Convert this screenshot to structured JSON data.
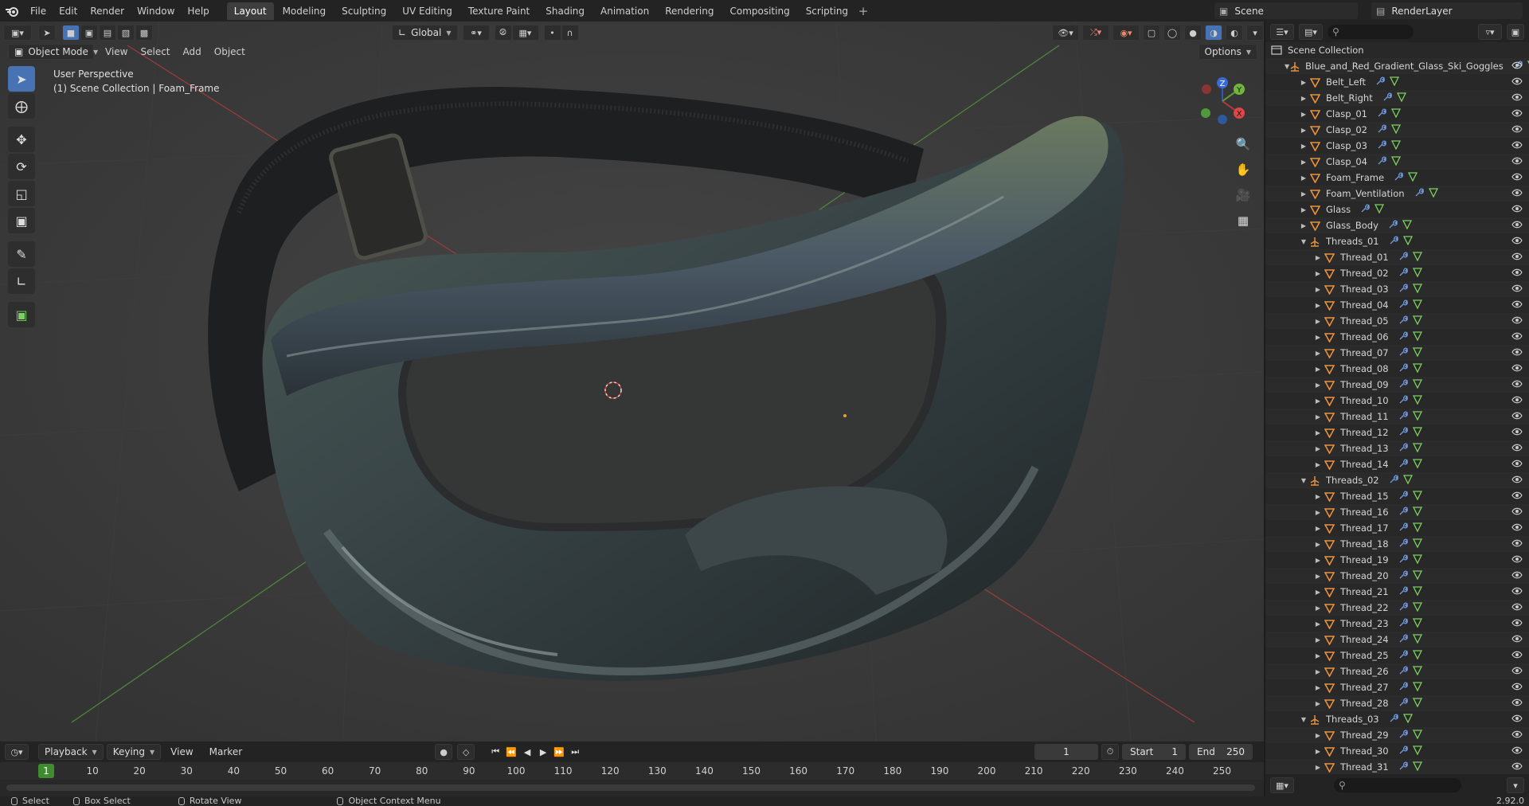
{
  "topbar": {
    "menu": [
      "File",
      "Edit",
      "Render",
      "Window",
      "Help"
    ],
    "workspaces": [
      "Layout",
      "Modeling",
      "Sculpting",
      "UV Editing",
      "Texture Paint",
      "Shading",
      "Animation",
      "Rendering",
      "Compositing",
      "Scripting"
    ],
    "active_workspace": "Layout",
    "add_tab": "+",
    "scene": "Scene",
    "view_layer": "RenderLayer"
  },
  "viewport": {
    "mode": "Object Mode",
    "menu": [
      "View",
      "Select",
      "Add",
      "Object"
    ],
    "transform_orientation": "Global",
    "options_label": "Options",
    "perspective_label": "User Perspective",
    "collection_label": "(1) Scene Collection | Foam_Frame",
    "gizmo_axes": [
      "X",
      "Y",
      "Z"
    ]
  },
  "outliner": {
    "root": "Scene Collection",
    "items": [
      {
        "label": "Blue_and_Red_Gradient_Glass_Ski_Goggles",
        "depth": 1,
        "type": "empty",
        "expanded": true
      },
      {
        "label": "Belt_Left",
        "depth": 2,
        "type": "mesh"
      },
      {
        "label": "Belt_Right",
        "depth": 2,
        "type": "mesh"
      },
      {
        "label": "Clasp_01",
        "depth": 2,
        "type": "mesh"
      },
      {
        "label": "Clasp_02",
        "depth": 2,
        "type": "mesh"
      },
      {
        "label": "Clasp_03",
        "depth": 2,
        "type": "mesh"
      },
      {
        "label": "Clasp_04",
        "depth": 2,
        "type": "mesh"
      },
      {
        "label": "Foam_Frame",
        "depth": 2,
        "type": "mesh"
      },
      {
        "label": "Foam_Ventilation",
        "depth": 2,
        "type": "mesh"
      },
      {
        "label": "Glass",
        "depth": 2,
        "type": "mesh"
      },
      {
        "label": "Glass_Body",
        "depth": 2,
        "type": "mesh"
      },
      {
        "label": "Threads_01",
        "depth": 2,
        "type": "empty",
        "expanded": true
      },
      {
        "label": "Thread_01",
        "depth": 3,
        "type": "mesh"
      },
      {
        "label": "Thread_02",
        "depth": 3,
        "type": "mesh"
      },
      {
        "label": "Thread_03",
        "depth": 3,
        "type": "mesh"
      },
      {
        "label": "Thread_04",
        "depth": 3,
        "type": "mesh"
      },
      {
        "label": "Thread_05",
        "depth": 3,
        "type": "mesh"
      },
      {
        "label": "Thread_06",
        "depth": 3,
        "type": "mesh"
      },
      {
        "label": "Thread_07",
        "depth": 3,
        "type": "mesh"
      },
      {
        "label": "Thread_08",
        "depth": 3,
        "type": "mesh"
      },
      {
        "label": "Thread_09",
        "depth": 3,
        "type": "mesh"
      },
      {
        "label": "Thread_10",
        "depth": 3,
        "type": "mesh"
      },
      {
        "label": "Thread_11",
        "depth": 3,
        "type": "mesh"
      },
      {
        "label": "Thread_12",
        "depth": 3,
        "type": "mesh"
      },
      {
        "label": "Thread_13",
        "depth": 3,
        "type": "mesh"
      },
      {
        "label": "Thread_14",
        "depth": 3,
        "type": "mesh"
      },
      {
        "label": "Threads_02",
        "depth": 2,
        "type": "empty",
        "expanded": true
      },
      {
        "label": "Thread_15",
        "depth": 3,
        "type": "mesh"
      },
      {
        "label": "Thread_16",
        "depth": 3,
        "type": "mesh"
      },
      {
        "label": "Thread_17",
        "depth": 3,
        "type": "mesh"
      },
      {
        "label": "Thread_18",
        "depth": 3,
        "type": "mesh"
      },
      {
        "label": "Thread_19",
        "depth": 3,
        "type": "mesh"
      },
      {
        "label": "Thread_20",
        "depth": 3,
        "type": "mesh"
      },
      {
        "label": "Thread_21",
        "depth": 3,
        "type": "mesh"
      },
      {
        "label": "Thread_22",
        "depth": 3,
        "type": "mesh"
      },
      {
        "label": "Thread_23",
        "depth": 3,
        "type": "mesh"
      },
      {
        "label": "Thread_24",
        "depth": 3,
        "type": "mesh"
      },
      {
        "label": "Thread_25",
        "depth": 3,
        "type": "mesh"
      },
      {
        "label": "Thread_26",
        "depth": 3,
        "type": "mesh"
      },
      {
        "label": "Thread_27",
        "depth": 3,
        "type": "mesh"
      },
      {
        "label": "Thread_28",
        "depth": 3,
        "type": "mesh"
      },
      {
        "label": "Threads_03",
        "depth": 2,
        "type": "empty",
        "expanded": true
      },
      {
        "label": "Thread_29",
        "depth": 3,
        "type": "mesh"
      },
      {
        "label": "Thread_30",
        "depth": 3,
        "type": "mesh"
      },
      {
        "label": "Thread_31",
        "depth": 3,
        "type": "mesh"
      }
    ]
  },
  "timeline": {
    "menu": [
      "Playback",
      "Keying",
      "View",
      "Marker"
    ],
    "current_frame": "1",
    "start_label": "Start",
    "start": "1",
    "end_label": "End",
    "end": "250",
    "ruler": [
      "10",
      "20",
      "30",
      "40",
      "50",
      "60",
      "70",
      "80",
      "90",
      "100",
      "110",
      "120",
      "130",
      "140",
      "150",
      "160",
      "170",
      "180",
      "190",
      "200",
      "210",
      "220",
      "230",
      "240",
      "250"
    ],
    "ruler_current": "1"
  },
  "statusbar": {
    "select": "Select",
    "box_select": "Box Select",
    "rotate_view": "Rotate View",
    "context_menu": "Object Context Menu",
    "version": "2.92.0"
  },
  "colors": {
    "accent": "#4772b3",
    "mesh_icon": "#e8913a",
    "modifier_icon": "#6f9ae0",
    "data_icon": "#7ccf62",
    "current_frame": "#3f8c2f"
  }
}
